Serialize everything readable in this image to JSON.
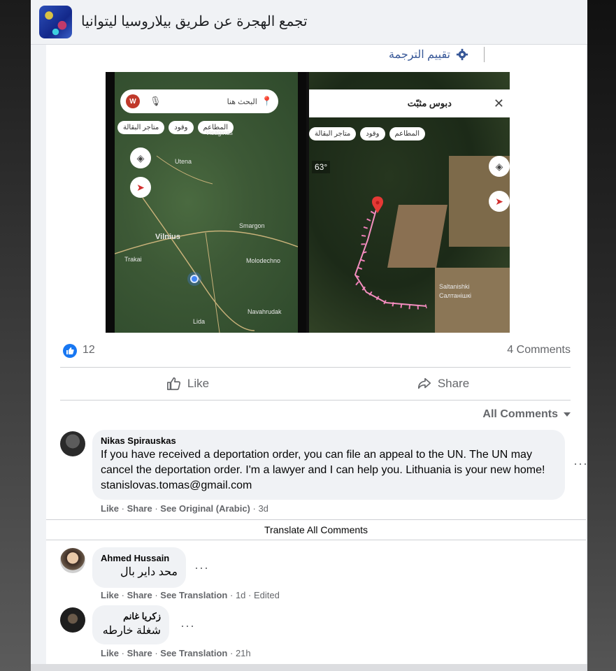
{
  "group": {
    "title": "تجمع الهجرة عن طريق بيلاروسيا ليتوانيا"
  },
  "post": {
    "rate_translation": "تقييم الترجمة",
    "map_left": {
      "search_placeholder": "البحث هنا",
      "avatar_letter": "W",
      "chips": [
        "المطاعم",
        "وقود",
        "متاجر البقالة"
      ],
      "labels": [
        "Utena",
        "Vilnius",
        "Trakai",
        "Molodechno",
        "Navahrudak",
        "Lida",
        "Smargon",
        "Visaginas"
      ]
    },
    "map_right": {
      "pinned_title": "دبوس مثبّت",
      "chips": [
        "المطاعم",
        "وقود",
        "متاجر البقالة"
      ],
      "temperature": "63°",
      "labels": [
        "Saltanishki",
        "Салтанішкі"
      ]
    },
    "like_count": "12",
    "comments_count": "4 Comments",
    "like_label": "Like",
    "share_label": "Share"
  },
  "comments_filter": "All Comments",
  "comments": [
    {
      "author": "Nikas Spirauskas",
      "text": "If you have received a deportation order, you can file an appeal to the UN. The UN may cancel the deportation order. I'm a lawyer and I can help you. Lithuania is your new home! stanislovas.tomas@gmail.com",
      "like": "Like",
      "share": "Share",
      "translate": "See Original (Arabic)",
      "time": "3d"
    },
    {
      "author": "Ahmed Hussain",
      "text": "محد داير بال",
      "like": "Like",
      "share": "Share",
      "translate": "See Translation",
      "time": "1d",
      "edited": "Edited"
    },
    {
      "author": "زكريا غانم",
      "text": "شغلة خارطه",
      "like": "Like",
      "share": "Share",
      "translate": "See Translation",
      "time": "21h"
    }
  ],
  "translate_all": "Translate All Comments",
  "colors": {
    "fb_blue": "#1877f2",
    "link_blue": "#385898",
    "muted": "#65676b"
  }
}
